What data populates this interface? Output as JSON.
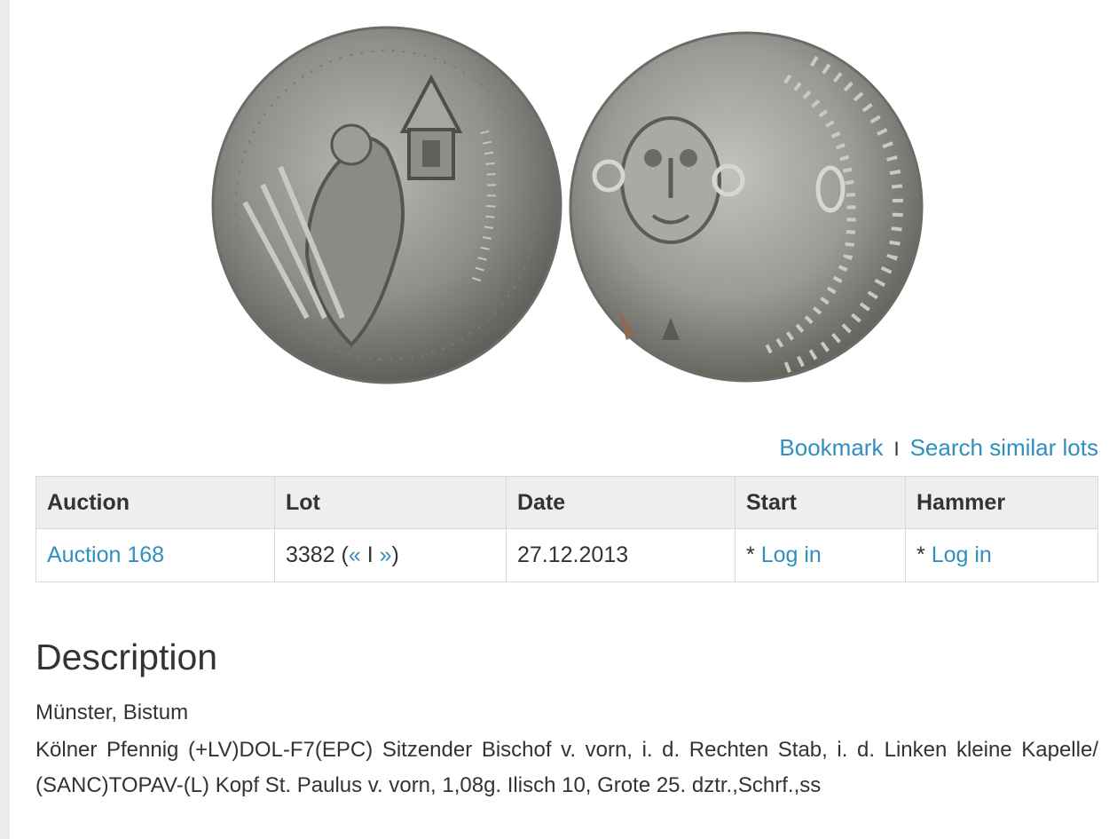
{
  "actions": {
    "bookmark": "Bookmark",
    "separator": "I",
    "search_similar": "Search similar lots"
  },
  "table": {
    "headers": [
      "Auction",
      "Lot",
      "Date",
      "Start",
      "Hammer"
    ],
    "row": {
      "auction": "Auction 168",
      "lot_number": "3382 (",
      "prev": "«",
      "nav_sep": " I ",
      "next": "»",
      "lot_close": ")",
      "date": "27.12.2013",
      "start_prefix": "* ",
      "start_link": "Log in",
      "hammer_prefix": "* ",
      "hammer_link": "Log in"
    }
  },
  "description": {
    "title": "Description",
    "location": "Münster, Bistum",
    "text": "Kölner Pfennig (+LV)DOL-F7(EPC) Sitzender Bischof v. vorn, i. d. Rechten Stab, i. d. Linken kleine Kapelle/ (SANC)TOPAV-(L) Kopf St. Paulus v. vorn, 1,08g. Ilisch 10, Grote 25. dztr.,Schrf.,ss"
  },
  "colors": {
    "link": "#2f8fbf",
    "header_bg": "#eeeeee",
    "coin_silver": "#9a9a98"
  }
}
